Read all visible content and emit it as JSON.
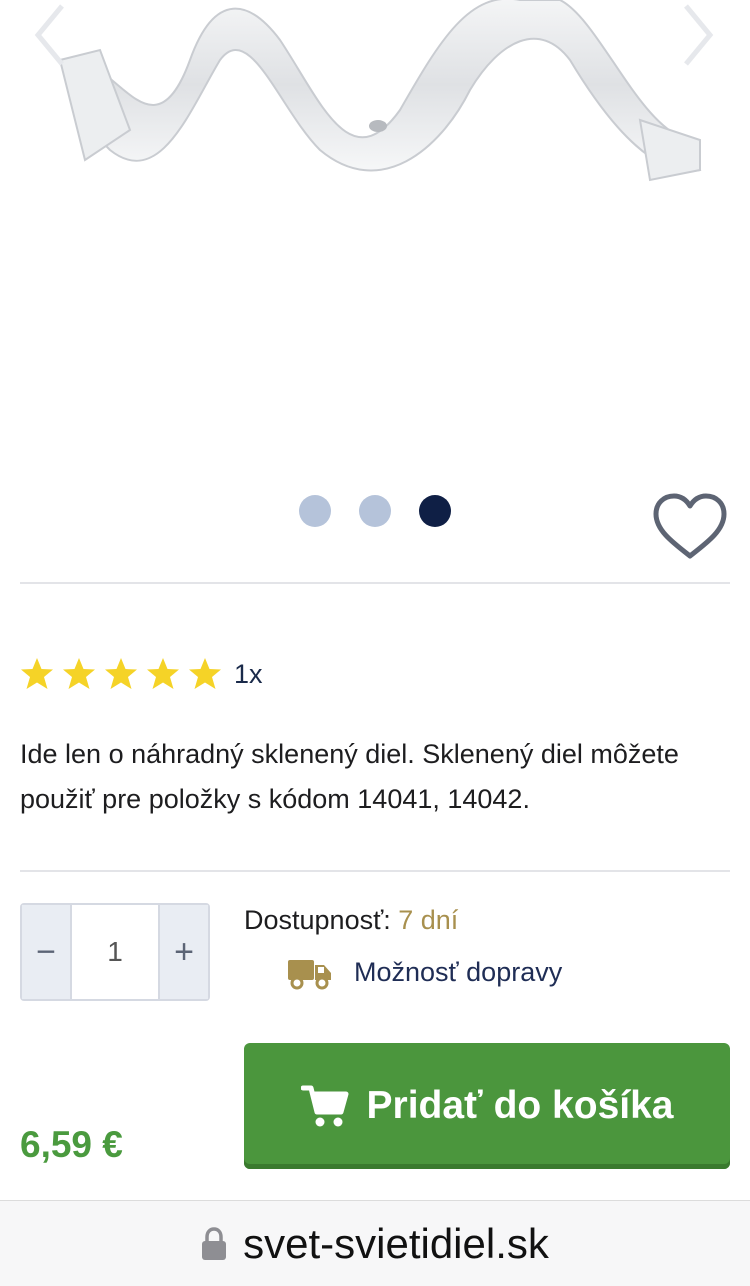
{
  "gallery": {
    "image_alt": "náhradný sklenený diel",
    "prev_icon": "chevron-left-icon",
    "next_icon": "chevron-right-icon",
    "slides_total": 3,
    "active_slide": 3,
    "dot_active_color": "#0f1f45",
    "dot_inactive_color": "#b5c3da"
  },
  "wishlist": {
    "icon": "heart-outline-icon",
    "color": "#5d6473"
  },
  "rating": {
    "stars": 5,
    "max": 5,
    "count_label": "1x",
    "star_color": "#f5d327"
  },
  "description": "Ide len o náhradný sklenený diel. Sklenený diel môžete použiť pre položky s kódom 14041, 14042.",
  "quantity": {
    "minus": "−",
    "value": "1",
    "plus": "+"
  },
  "availability": {
    "label": "Dostupnosť:",
    "value": "7 dní"
  },
  "shipping": {
    "label": "Možnosť dopravy",
    "icon": "truck-icon"
  },
  "price": "6,59 €",
  "cart_button": {
    "label": "Pridať do košíka",
    "icon": "cart-icon",
    "color": "#4b963d"
  },
  "browser": {
    "url": "svet-svietidiel.sk",
    "icon": "lock-icon"
  }
}
